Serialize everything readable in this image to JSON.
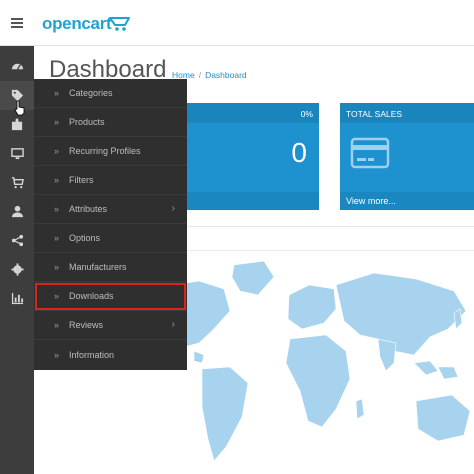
{
  "header": {
    "logo_text": "opencart",
    "menu_icon": "hamburger-icon"
  },
  "page": {
    "title": "Dashboard",
    "breadcrumb": [
      "Home",
      "Dashboard"
    ],
    "breadcrumb_separator": "/"
  },
  "sidebar": {
    "icons": [
      "dashboard-icon",
      "tag-icon",
      "puzzle-icon",
      "monitor-icon",
      "cart-icon",
      "user-icon",
      "share-icon",
      "gear-icon",
      "bar-chart-icon"
    ]
  },
  "flyout": {
    "items": [
      {
        "label": "Categories",
        "submenu": false
      },
      {
        "label": "Products",
        "submenu": false
      },
      {
        "label": "Recurring Profiles",
        "submenu": false
      },
      {
        "label": "Filters",
        "submenu": false
      },
      {
        "label": "Attributes",
        "submenu": true
      },
      {
        "label": "Options",
        "submenu": false
      },
      {
        "label": "Manufacturers",
        "submenu": false
      },
      {
        "label": "Downloads",
        "submenu": false,
        "highlighted": true
      },
      {
        "label": "Reviews",
        "submenu": true
      },
      {
        "label": "Information",
        "submenu": false
      }
    ],
    "chevron": "»",
    "submenu_arrow": "›",
    "highlight_color": "#d9241c"
  },
  "tiles": {
    "customers": {
      "percent": "0%",
      "value": "0"
    },
    "sales": {
      "title": "TOTAL SALES",
      "footer": "View more..."
    }
  },
  "colors": {
    "accent": "#1e91cf",
    "sidebar": "#3d3d3d",
    "flyout": "#2f2f2f",
    "map_land": "#a8d3ee"
  }
}
